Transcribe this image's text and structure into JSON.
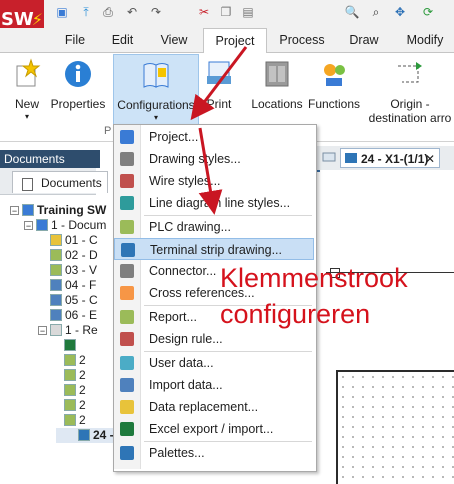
{
  "app": {
    "logo_text": "SW",
    "logo_bolt": "⚡"
  },
  "quick_access": [
    {
      "name": "new-icon",
      "glyph": "▣",
      "color": "#3a7bd5"
    },
    {
      "name": "upload-icon",
      "glyph": "⤒",
      "color": "#2a8fd8"
    },
    {
      "name": "print-icon",
      "glyph": "⎙",
      "color": "#555"
    },
    {
      "name": "undo-icon",
      "glyph": "↶",
      "color": "#555"
    },
    {
      "name": "redo-icon",
      "glyph": "↷",
      "color": "#555"
    },
    {
      "name": "cut-icon",
      "glyph": "✂",
      "color": "#c8202b"
    },
    {
      "name": "copy-icon",
      "glyph": "❐",
      "color": "#777"
    },
    {
      "name": "paste-icon",
      "glyph": "▤",
      "color": "#777"
    },
    {
      "name": "zoom-icon",
      "glyph": "🔍",
      "color": "#333"
    },
    {
      "name": "zoom-fit-icon",
      "glyph": "⌕",
      "color": "#333"
    },
    {
      "name": "pan-icon",
      "glyph": "✥",
      "color": "#2a6fb5"
    },
    {
      "name": "refresh-icon",
      "glyph": "⟳",
      "color": "#2c9a3c"
    }
  ],
  "menu_tabs": [
    "File",
    "Edit",
    "View",
    "Project",
    "Process",
    "Draw",
    "Modify"
  ],
  "ribbon": {
    "new": "New",
    "properties": "Properties",
    "configurations": "Configurations",
    "print": "Print",
    "locations": "Locations",
    "functions": "Functions",
    "origin_line1": "Origin -",
    "origin_line2": "destination arro",
    "group_label": "P"
  },
  "documents_panel": {
    "header": "Documents",
    "tab": "Documents"
  },
  "doc_tab": {
    "title": "24 - X1-(1/1)",
    "close": "✕"
  },
  "tree": [
    {
      "indent": 0,
      "expander": "−",
      "text": "Training SW",
      "bold": true,
      "icon": "#3a7bd5"
    },
    {
      "indent": 1,
      "expander": "−",
      "text": "1 - Docum",
      "bold": false,
      "icon": "#3a7bd5"
    },
    {
      "indent": 2,
      "expander": "",
      "text": "01 - C",
      "bold": false,
      "icon": "#e8c33a"
    },
    {
      "indent": 2,
      "expander": "",
      "text": "02 - D",
      "bold": false,
      "icon": "#9bbb59"
    },
    {
      "indent": 2,
      "expander": "",
      "text": "03 - V",
      "bold": false,
      "icon": "#9bbb59"
    },
    {
      "indent": 2,
      "expander": "",
      "text": "04 - F",
      "bold": false,
      "icon": "#4f81bd"
    },
    {
      "indent": 2,
      "expander": "",
      "text": "05 - C",
      "bold": false,
      "icon": "#4f81bd"
    },
    {
      "indent": 2,
      "expander": "",
      "text": "06 - E",
      "bold": false,
      "icon": "#4f81bd"
    },
    {
      "indent": 2,
      "expander": "−",
      "text": "1 - Re",
      "bold": false,
      "icon": "#d9d9d9"
    },
    {
      "indent": 3,
      "expander": "",
      "text": "",
      "bold": false,
      "icon": "#1f7a3d"
    },
    {
      "indent": 3,
      "expander": "",
      "text": "2",
      "bold": false,
      "icon": "#9bbb59"
    },
    {
      "indent": 3,
      "expander": "",
      "text": "2",
      "bold": false,
      "icon": "#9bbb59"
    },
    {
      "indent": 3,
      "expander": "",
      "text": "2",
      "bold": false,
      "icon": "#9bbb59"
    },
    {
      "indent": 3,
      "expander": "",
      "text": "2",
      "bold": false,
      "icon": "#9bbb59"
    },
    {
      "indent": 3,
      "expander": "",
      "text": "2",
      "bold": false,
      "icon": "#9bbb59"
    },
    {
      "indent": 3,
      "expander": "",
      "text": "24 -",
      "bold": true,
      "icon": "#2e75b6"
    }
  ],
  "dropdown": [
    {
      "label": "Project...",
      "color": "#3a7bd5",
      "sep": false
    },
    {
      "label": "Drawing styles...",
      "color": "#7f7f7f",
      "sep": false
    },
    {
      "label": "Wire styles...",
      "color": "#c0504d",
      "sep": false
    },
    {
      "label": "Line diagram line styles...",
      "color": "#2e9b9b",
      "sep": true
    },
    {
      "label": "PLC drawing...",
      "color": "#9bbb59",
      "sep": false
    },
    {
      "label": "Terminal strip drawing...",
      "color": "#2e75b6",
      "sep": false,
      "highlight": true
    },
    {
      "label": "Connector...",
      "color": "#7f7f7f",
      "sep": false
    },
    {
      "label": "Cross references...",
      "color": "#f79646",
      "sep": true
    },
    {
      "label": "Report...",
      "color": "#9bbb59",
      "sep": false
    },
    {
      "label": "Design rule...",
      "color": "#c0504d",
      "sep": true
    },
    {
      "label": "User data...",
      "color": "#4bacc6",
      "sep": false
    },
    {
      "label": "Import data...",
      "color": "#4f81bd",
      "sep": false
    },
    {
      "label": "Data replacement...",
      "color": "#e8c33a",
      "sep": false
    },
    {
      "label": "Excel export / import...",
      "color": "#1f7a3d",
      "sep": true
    },
    {
      "label": "Palettes...",
      "color": "#2e75b6",
      "sep": false
    }
  ],
  "annotation": {
    "line1": "Klemmenstrook",
    "line2": "configureren",
    "color": "#d5121c"
  }
}
